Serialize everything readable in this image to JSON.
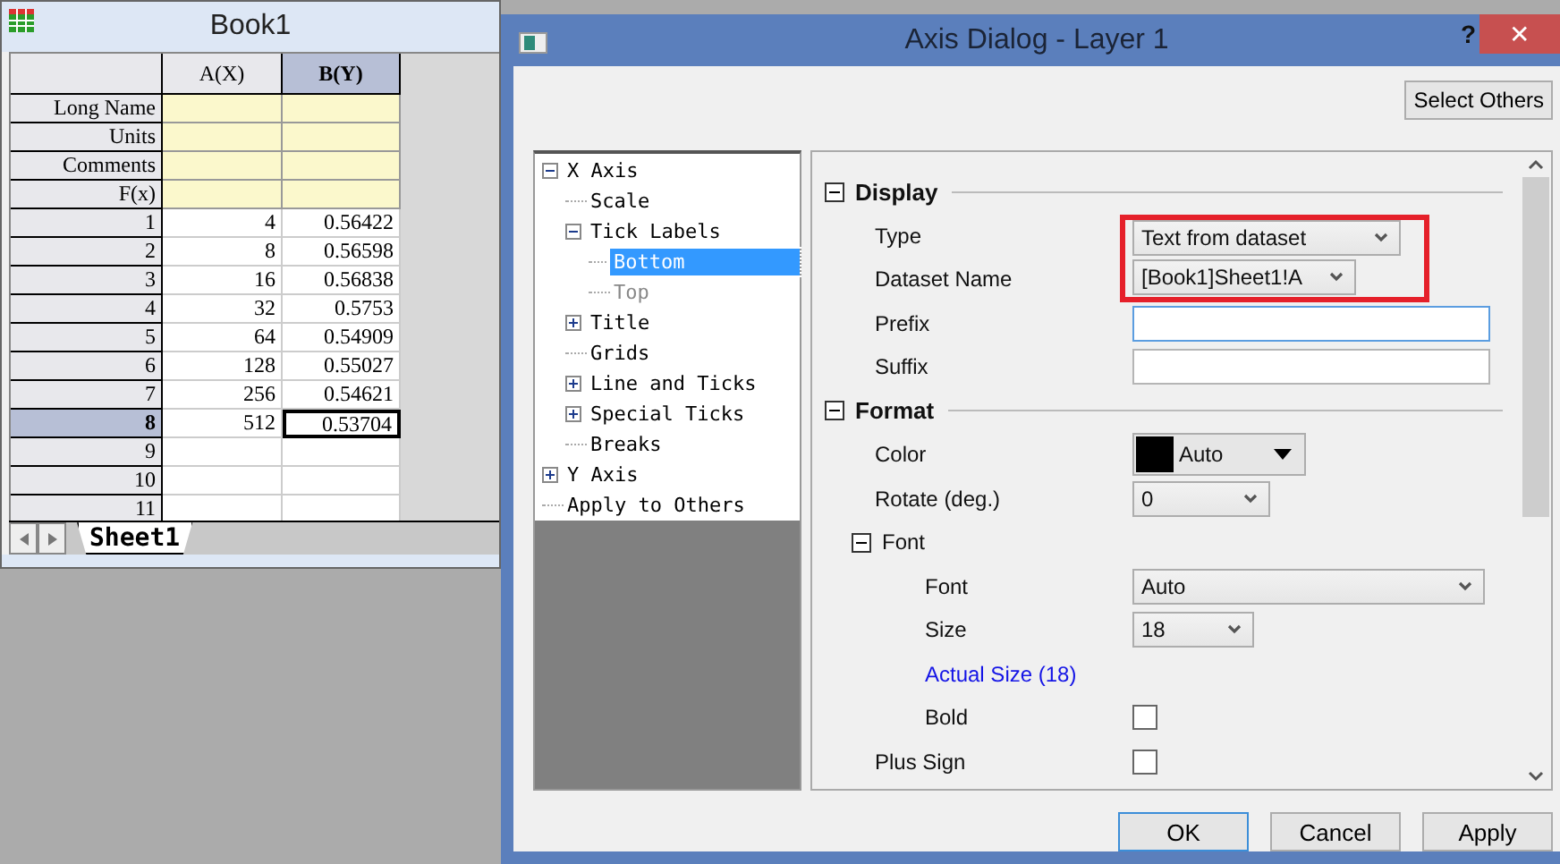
{
  "workbook": {
    "title": "Book1",
    "columns": [
      {
        "label": "A(X)",
        "selected": false
      },
      {
        "label": "B(Y)",
        "selected": true
      }
    ],
    "meta_rows": [
      "Long Name",
      "Units",
      "Comments",
      "F(x)"
    ],
    "rows": [
      {
        "label": "1",
        "cells": [
          "4",
          "0.56422"
        ],
        "selected": false
      },
      {
        "label": "2",
        "cells": [
          "8",
          "0.56598"
        ],
        "selected": false
      },
      {
        "label": "3",
        "cells": [
          "16",
          "0.56838"
        ],
        "selected": false
      },
      {
        "label": "4",
        "cells": [
          "32",
          "0.5753"
        ],
        "selected": false
      },
      {
        "label": "5",
        "cells": [
          "64",
          "0.54909"
        ],
        "selected": false
      },
      {
        "label": "6",
        "cells": [
          "128",
          "0.55027"
        ],
        "selected": false
      },
      {
        "label": "7",
        "cells": [
          "256",
          "0.54621"
        ],
        "selected": false
      },
      {
        "label": "8",
        "cells": [
          "512",
          "0.53704"
        ],
        "selected": true
      },
      {
        "label": "9",
        "cells": [],
        "selected": false
      },
      {
        "label": "10",
        "cells": [],
        "selected": false
      },
      {
        "label": "11",
        "cells": [],
        "selected": false
      }
    ],
    "sheet_tabs": [
      {
        "label": "Sheet1",
        "selected": true
      }
    ]
  },
  "dialog": {
    "title": "Axis Dialog - Layer 1",
    "help_button": "?",
    "close_button": "✕",
    "select_others": "Select Others",
    "tree": [
      {
        "label": "X Axis",
        "expanded": true,
        "selected": false,
        "disabled": false,
        "children": [
          {
            "label": "Scale",
            "selected": false,
            "disabled": false
          },
          {
            "label": "Tick Labels",
            "expanded": true,
            "selected": false,
            "disabled": false,
            "children": [
              {
                "label": "Bottom",
                "selected": true,
                "disabled": false
              },
              {
                "label": "Top",
                "selected": false,
                "disabled": true
              }
            ]
          },
          {
            "label": "Title",
            "expanded": false,
            "selected": false,
            "disabled": false
          },
          {
            "label": "Grids",
            "selected": false,
            "disabled": false
          },
          {
            "label": "Line and Ticks",
            "expanded": false,
            "selected": false,
            "disabled": false
          },
          {
            "label": "Special Ticks",
            "expanded": false,
            "selected": false,
            "disabled": false
          },
          {
            "label": "Breaks",
            "selected": false,
            "disabled": false
          }
        ]
      },
      {
        "label": "Y Axis",
        "expanded": false,
        "selected": false,
        "disabled": false
      },
      {
        "label": "Apply to Others",
        "selected": false,
        "disabled": false
      }
    ],
    "sections": [
      {
        "title": "Display",
        "expanded": true,
        "rows": [
          {
            "kind": "dropdown",
            "label": "Type",
            "value": "Text from dataset",
            "highlighted": true
          },
          {
            "kind": "dropdown",
            "label": "Dataset Name",
            "value": "[Book1]Sheet1!A",
            "highlighted": true
          },
          {
            "kind": "text",
            "label": "Prefix",
            "focused": true
          },
          {
            "kind": "text",
            "label": "Suffix",
            "focused": false
          }
        ]
      },
      {
        "title": "Format",
        "expanded": true,
        "rows": [
          {
            "kind": "color",
            "label": "Color",
            "value": "Auto",
            "color": "#000000"
          },
          {
            "kind": "dropdown",
            "label": "Rotate (deg.)",
            "value": "0"
          },
          {
            "kind": "group",
            "label": "Font",
            "expanded": true,
            "children": [
              {
                "kind": "dropdown",
                "label": "Font",
                "value": "Auto"
              },
              {
                "kind": "dropdown",
                "label": "Size",
                "value": "18"
              },
              {
                "kind": "link",
                "label": "Actual Size (18)"
              },
              {
                "kind": "checkbox",
                "label": "Bold",
                "checked": false
              }
            ]
          },
          {
            "kind": "checkbox",
            "label": "Plus Sign",
            "checked": false
          }
        ]
      }
    ],
    "buttons": [
      {
        "label": "OK",
        "default": true
      },
      {
        "label": "Cancel",
        "default": false
      },
      {
        "label": "Apply",
        "default": false
      }
    ]
  }
}
